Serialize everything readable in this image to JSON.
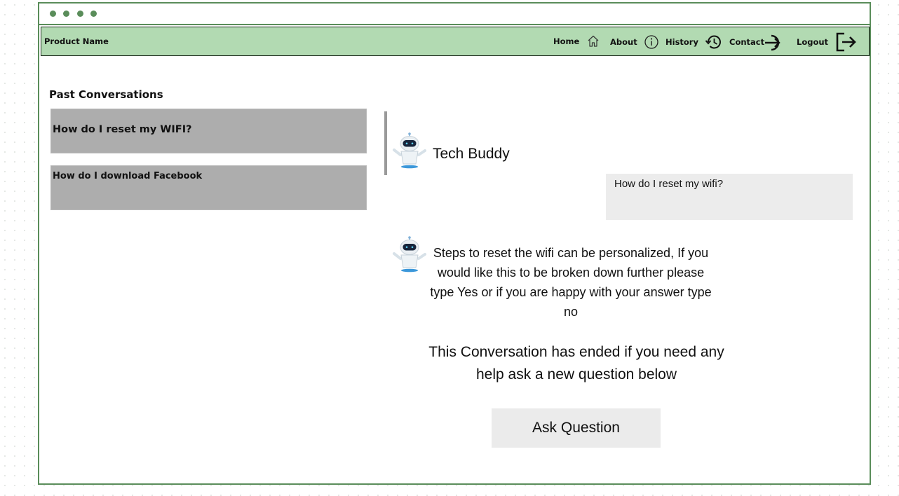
{
  "window": {
    "dots": [
      "dot",
      "dot",
      "dot",
      "dot"
    ]
  },
  "navbar": {
    "brand": "Product Name",
    "items": [
      {
        "label": "Home",
        "icon": "home-icon"
      },
      {
        "label": "About",
        "icon": "info-icon"
      },
      {
        "label": "History",
        "icon": "history-icon"
      },
      {
        "label": "Contact",
        "icon": "login-arrow-icon"
      },
      {
        "label": "Logout",
        "icon": "logout-icon"
      }
    ]
  },
  "sidebar": {
    "title": "Past Conversations",
    "conversations": [
      {
        "label": "How do I reset my WIFI?"
      },
      {
        "label": "How do I download Facebook"
      }
    ]
  },
  "chat": {
    "bot_name": "Tech Buddy",
    "bot_avatar_icon": "robot-icon",
    "user_message": "How do I reset my wifi?",
    "bot_reply": "Steps to reset the wifi can be personalized, If you would like this to be broken down further please type Yes or if you are happy with your answer type no",
    "ended_notice": "This Conversation has ended if you need any help ask a new question below",
    "ask_button": "Ask Question"
  },
  "colors": {
    "accent_green": "#5a8d5a",
    "navbar_bg": "#b2dab2",
    "conversation_bg": "#adadad",
    "bubble_bg": "#ececec"
  }
}
